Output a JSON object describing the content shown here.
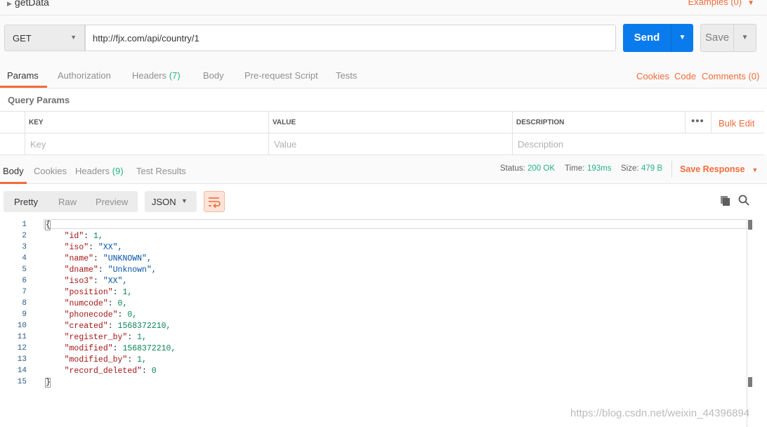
{
  "request": {
    "name": "getData",
    "examples_label": "Examples (0)"
  },
  "url_bar": {
    "method": "GET",
    "url": "http://fjx.com/api/country/1",
    "send_label": "Send",
    "save_label": "Save"
  },
  "request_tabs": {
    "params": "Params",
    "authorization": "Authorization",
    "headers": "Headers",
    "headers_count": "(7)",
    "body": "Body",
    "prerequest": "Pre-request Script",
    "tests": "Tests",
    "cookies": "Cookies",
    "code": "Code",
    "comments": "Comments (0)"
  },
  "query_params": {
    "title": "Query Params",
    "headers": {
      "key": "KEY",
      "value": "VALUE",
      "description": "DESCRIPTION"
    },
    "placeholders": {
      "key": "Key",
      "value": "Value",
      "description": "Description"
    },
    "bulk_edit": "Bulk Edit"
  },
  "response_tabs": {
    "body": "Body",
    "cookies": "Cookies",
    "headers": "Headers",
    "headers_count": "(9)",
    "test_results": "Test Results"
  },
  "response_meta": {
    "status_label": "Status:",
    "status_value": "200 OK",
    "time_label": "Time:",
    "time_value": "193ms",
    "size_label": "Size:",
    "size_value": "479 B",
    "save_response": "Save Response"
  },
  "viewer": {
    "pretty": "Pretty",
    "raw": "Raw",
    "preview": "Preview",
    "format": "JSON"
  },
  "code_lines": [
    {
      "num": "1",
      "key": "",
      "value": "",
      "vtype": ""
    },
    {
      "num": "2",
      "key": "\"id\"",
      "value": "1,",
      "vtype": "n"
    },
    {
      "num": "3",
      "key": "\"iso\"",
      "value": "\"XX\",",
      "vtype": "s"
    },
    {
      "num": "4",
      "key": "\"name\"",
      "value": "\"UNKNOWN\",",
      "vtype": "s"
    },
    {
      "num": "5",
      "key": "\"dname\"",
      "value": "\"Unknown\",",
      "vtype": "s"
    },
    {
      "num": "6",
      "key": "\"iso3\"",
      "value": "\"XX\",",
      "vtype": "s"
    },
    {
      "num": "7",
      "key": "\"position\"",
      "value": "1,",
      "vtype": "n"
    },
    {
      "num": "8",
      "key": "\"numcode\"",
      "value": "0,",
      "vtype": "n"
    },
    {
      "num": "9",
      "key": "\"phonecode\"",
      "value": "0,",
      "vtype": "n"
    },
    {
      "num": "10",
      "key": "\"created\"",
      "value": "1568372210,",
      "vtype": "n"
    },
    {
      "num": "11",
      "key": "\"register_by\"",
      "value": "1,",
      "vtype": "n"
    },
    {
      "num": "12",
      "key": "\"modified\"",
      "value": "1568372210,",
      "vtype": "n"
    },
    {
      "num": "13",
      "key": "\"modified_by\"",
      "value": "1,",
      "vtype": "n"
    },
    {
      "num": "14",
      "key": "\"record_deleted\"",
      "value": "0",
      "vtype": "n"
    },
    {
      "num": "15",
      "key": "",
      "value": "",
      "vtype": ""
    }
  ],
  "braces": {
    "open": "{",
    "close": "}"
  },
  "watermark": "https://blog.csdn.net/weixin_44396894",
  "colors": {
    "accent": "#f26b3a",
    "send": "#097bed",
    "status_ok": "#26b47f"
  },
  "icons": [
    "caret-right-icon",
    "chevron-down-icon",
    "more-icon",
    "wrap-lines-icon",
    "copy-icon",
    "search-icon"
  ]
}
